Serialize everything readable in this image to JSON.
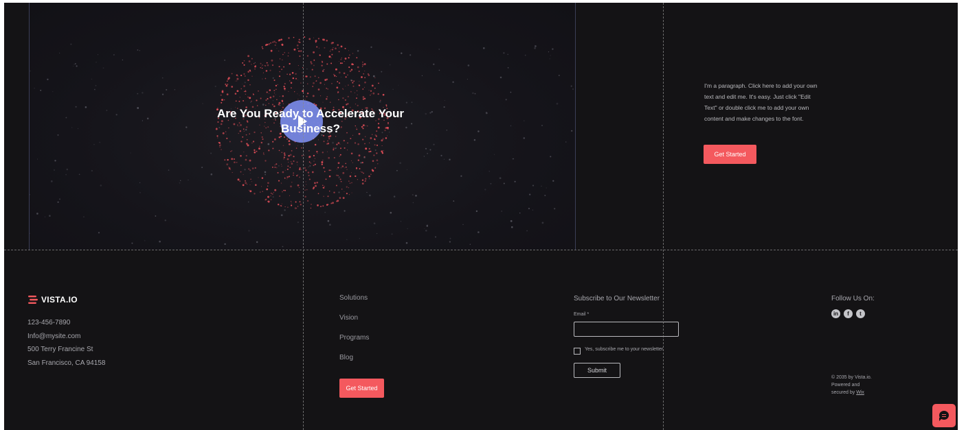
{
  "hero": {
    "title": "Are You Ready to Accelerate Your Business?",
    "paragraph": "I'm a paragraph. Click here to add your own text and edit me. It's easy. Just click \"Edit Text\" or double click me to add your own content and make changes to the font.",
    "cta_label": "Get Started",
    "play_icon": "play-icon"
  },
  "footer": {
    "logo_text": "VISTA.IO",
    "contact": {
      "phone": "123-456-7890",
      "email": "Info@mysite.com",
      "street": "500 Terry Francine St",
      "city": "San Francisco, CA 94158"
    },
    "nav": [
      "Solutions",
      "Vision",
      "Programs",
      "Blog"
    ],
    "cta_label": "Get Started",
    "newsletter": {
      "title": "Subscribe to Our Newsletter",
      "email_label": "Email *",
      "email_value": "",
      "checkbox_label": "Yes, subscribe me to your newsletter.",
      "submit_label": "Submit"
    },
    "follow": {
      "title": "Follow Us On:",
      "icons": [
        "linkedin-icon",
        "facebook-icon",
        "twitter-icon"
      ]
    },
    "copyright": {
      "line1": "© 2035 by Vista.io.",
      "line2": "Powered and",
      "line3_prefix": "secured by",
      "link": "Wix"
    }
  },
  "chat": {
    "icon": "chat-icon"
  },
  "colors": {
    "background": "#141315",
    "accent": "#f4595e",
    "play_button": "#7a8ae8",
    "text_muted": "#a8a8ae"
  }
}
